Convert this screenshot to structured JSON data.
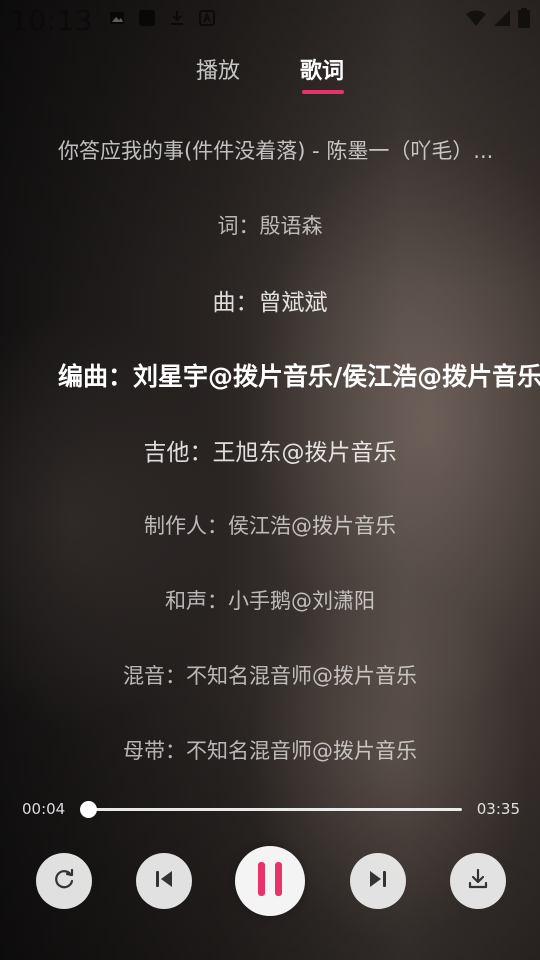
{
  "status_bar": {
    "time": "10:13",
    "icons": [
      "image-icon",
      "square-app-icon",
      "download-icon",
      "a-box-icon"
    ],
    "right_icons": [
      "wifi-icon",
      "signal-icon",
      "battery-icon"
    ]
  },
  "tabs": [
    {
      "label": "播放",
      "active": false
    },
    {
      "label": "歌词",
      "active": true
    }
  ],
  "accent_color": "#e8336a",
  "lyrics": {
    "title": "你答应我的事(件件没着落) - 陈墨一（吖毛）...",
    "lines": [
      "词：殷语森",
      "曲：曾斌斌",
      "编曲：刘星宇@拨片音乐/侯江浩@拨片音乐",
      "吉他：王旭东@拨片音乐",
      "制作人：侯江浩@拨片音乐",
      "和声：小手鹅@刘潇阳",
      "混音：不知名混音师@拨片音乐",
      "母带：不知名混音师@拨片音乐"
    ],
    "current_index": 2
  },
  "player": {
    "current_time": "00:04",
    "duration": "03:35",
    "progress": 0.0
  },
  "controls": {
    "repeat": "repeat-icon",
    "previous": "skip-previous-icon",
    "play_pause": "pause-icon",
    "next": "skip-next-icon",
    "download": "download-icon"
  }
}
